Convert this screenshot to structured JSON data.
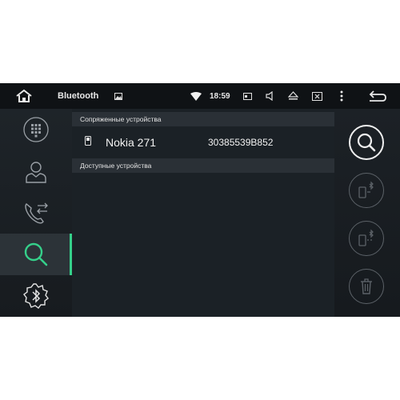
{
  "statusbar": {
    "title": "Bluetooth",
    "time": "18:59",
    "icons": [
      "home-icon",
      "image-icon",
      "wifi-icon",
      "cast-icon",
      "volume-icon",
      "eject-icon",
      "screen-close-icon",
      "menu-icon",
      "back-icon"
    ]
  },
  "rail": {
    "items": [
      {
        "icon": "dialpad-icon",
        "active": false
      },
      {
        "icon": "contacts-icon",
        "active": false
      },
      {
        "icon": "call-log-icon",
        "active": false
      },
      {
        "icon": "search-icon",
        "active": true
      },
      {
        "icon": "bluetooth-settings-icon",
        "active": false
      }
    ]
  },
  "list": {
    "paired_header": "Сопряженные устройства",
    "available_header": "Доступные устройства",
    "paired_devices": [
      {
        "name": "Nokia 271",
        "address": "30385539B852"
      }
    ]
  },
  "actions": [
    {
      "icon": "search-icon",
      "primary": true
    },
    {
      "icon": "phone-connect-icon",
      "primary": false
    },
    {
      "icon": "phone-disconnect-icon",
      "primary": false
    },
    {
      "icon": "trash-icon",
      "primary": false
    }
  ],
  "colors": {
    "accent": "#35d08a",
    "background": "#1a1f24",
    "header": "#2a3036"
  }
}
